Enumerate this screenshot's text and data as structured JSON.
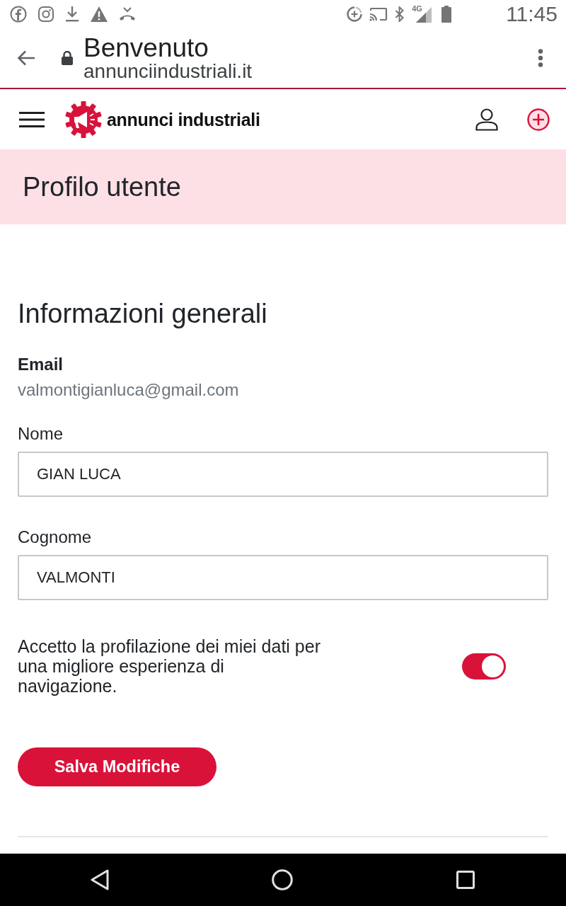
{
  "status_bar": {
    "network": "4G",
    "time": "11:45"
  },
  "browser": {
    "title": "Benvenuto",
    "url": "annunciindustriali.it"
  },
  "header": {
    "logo_text": "annunci industriali"
  },
  "banner": {
    "title": "Profilo utente"
  },
  "section": {
    "title": "Informazioni generali"
  },
  "email": {
    "label": "Email",
    "value": "valmontigianluca@gmail.com"
  },
  "fields": [
    {
      "label": "Nome",
      "value": "GIAN LUCA"
    },
    {
      "label": "Cognome",
      "value": "VALMONTI"
    }
  ],
  "consent": {
    "text": "Accetto la profilazione dei miei dati per una migliore esperienza di navigazione.",
    "on": true
  },
  "save_button": {
    "label": "Salva Modifiche"
  }
}
